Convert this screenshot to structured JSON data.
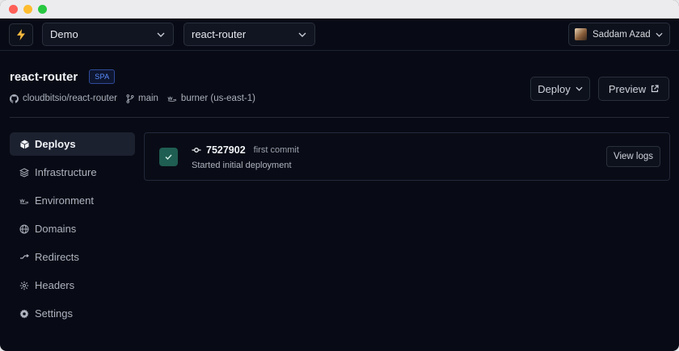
{
  "topbar": {
    "team_select": "Demo",
    "project_select": "react-router",
    "user_name": "Saddam Azad"
  },
  "project": {
    "name": "react-router",
    "badge": "SPA",
    "repo": "cloudbitsio/react-router",
    "branch": "main",
    "environment": "burner (us-east-1)"
  },
  "actions": {
    "deploy_label": "Deploy",
    "preview_label": "Preview"
  },
  "sidebar": {
    "items": [
      {
        "label": "Deploys",
        "icon": "cube-icon",
        "active": true
      },
      {
        "label": "Infrastructure",
        "icon": "layers-icon",
        "active": false
      },
      {
        "label": "Environment",
        "icon": "aws-icon",
        "active": false
      },
      {
        "label": "Domains",
        "icon": "globe-icon",
        "active": false
      },
      {
        "label": "Redirects",
        "icon": "redirect-icon",
        "active": false
      },
      {
        "label": "Headers",
        "icon": "headers-icon",
        "active": false
      },
      {
        "label": "Settings",
        "icon": "gear-icon",
        "active": false
      }
    ]
  },
  "deploys": [
    {
      "commit": "7527902",
      "message": "first commit",
      "status_text": "Started initial deployment",
      "logs_label": "View logs",
      "status": "success"
    }
  ],
  "colors": {
    "accent": "#5b8dff",
    "success": "#1f5e52",
    "background": "#080b15"
  }
}
